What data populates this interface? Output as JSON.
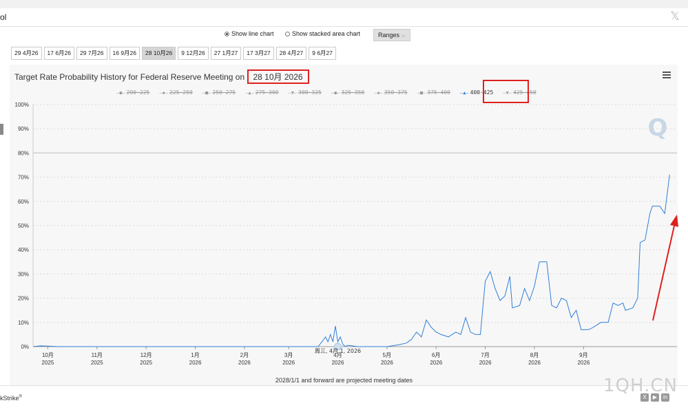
{
  "header": {
    "title_fragment": "ol",
    "close_label": "𝕏"
  },
  "options": {
    "line_label": "Show line chart",
    "stacked_label": "Show stacked area chart",
    "ranges_label": "Ranges",
    "selected": "line"
  },
  "meeting_tabs": [
    "29 4月26",
    "17 6月26",
    "29 7月26",
    "16 9月26",
    "28 10月26",
    "9 12月26",
    "27 1月27",
    "17 3月27",
    "28 4月27",
    "9 6月27"
  ],
  "active_tab": 4,
  "chart": {
    "title_prefix": "Target Rate Probability History for Federal Reserve Meeting on",
    "title_date": "28 10月 2026"
  },
  "legend_items": [
    {
      "label": "200-225",
      "symbol": "●",
      "active": false
    },
    {
      "label": "225-250",
      "symbol": "◆",
      "active": false
    },
    {
      "label": "250-275",
      "symbol": "■",
      "active": false
    },
    {
      "label": "275-300",
      "symbol": "▲",
      "active": false
    },
    {
      "label": "300-325",
      "symbol": "▼",
      "active": false
    },
    {
      "label": "325-350",
      "symbol": "●",
      "active": false
    },
    {
      "label": "350-375",
      "symbol": "◆",
      "active": false
    },
    {
      "label": "375-400",
      "symbol": "■",
      "active": false
    },
    {
      "label": "400-425",
      "symbol": "▲",
      "active": true
    },
    {
      "label": "425-450",
      "symbol": "▼",
      "active": false
    }
  ],
  "tooltip_date": "周三, 4月 1, 2026",
  "footnote": "2028/1/1 and forward are projected meeting dates",
  "credit": "kStrike",
  "credit_mark": "®",
  "watermark": "1QH.CN",
  "logo_letter": "Q",
  "colors": {
    "series": "#2f7ed8",
    "highlight": "#e01f1f",
    "grid": "#d8d8d8"
  },
  "chart_data": {
    "type": "line",
    "title": "Target Rate Probability History for Federal Reserve Meeting on 28 10月 2026",
    "y_unit": "%",
    "ylim": [
      0,
      100
    ],
    "y_ticks": [
      0,
      10,
      20,
      30,
      40,
      50,
      60,
      70,
      80,
      90,
      100
    ],
    "xlim": [
      0,
      13.1
    ],
    "x_ticks": [
      {
        "value": 0.3,
        "month": "10月",
        "year": "2025"
      },
      {
        "value": 1.3,
        "month": "11月",
        "year": "2025"
      },
      {
        "value": 2.3,
        "month": "12月",
        "year": "2025"
      },
      {
        "value": 3.3,
        "month": "1月",
        "year": "2026"
      },
      {
        "value": 4.3,
        "month": "2月",
        "year": "2026"
      },
      {
        "value": 5.2,
        "month": "3月",
        "year": "2026"
      },
      {
        "value": 6.2,
        "month": "4月",
        "year": "2026"
      },
      {
        "value": 7.2,
        "month": "5月",
        "year": "2026"
      },
      {
        "value": 8.2,
        "month": "6月",
        "year": "2026"
      },
      {
        "value": 9.2,
        "month": "7月",
        "year": "2026"
      },
      {
        "value": 10.2,
        "month": "8月",
        "year": "2026"
      },
      {
        "value": 11.2,
        "month": "9月",
        "year": "2026"
      }
    ],
    "series": [
      {
        "name": "400-425",
        "points": [
          [
            0.0,
            0
          ],
          [
            0.15,
            0.3
          ],
          [
            0.3,
            0.2
          ],
          [
            0.5,
            0
          ],
          [
            1.3,
            0
          ],
          [
            2.3,
            0
          ],
          [
            3.3,
            0
          ],
          [
            4.3,
            0
          ],
          [
            5.2,
            0
          ],
          [
            5.8,
            0
          ],
          [
            5.95,
            4
          ],
          [
            6.0,
            2
          ],
          [
            6.05,
            5
          ],
          [
            6.1,
            2
          ],
          [
            6.15,
            8.5
          ],
          [
            6.2,
            2
          ],
          [
            6.25,
            4
          ],
          [
            6.3,
            1
          ],
          [
            6.35,
            0
          ],
          [
            6.4,
            0.5
          ],
          [
            6.5,
            0.3
          ],
          [
            6.6,
            0
          ],
          [
            7.2,
            0
          ],
          [
            7.3,
            0.3
          ],
          [
            7.45,
            0.8
          ],
          [
            7.6,
            1.5
          ],
          [
            7.7,
            3
          ],
          [
            7.8,
            6
          ],
          [
            7.9,
            4
          ],
          [
            8.0,
            11
          ],
          [
            8.1,
            8
          ],
          [
            8.2,
            6
          ],
          [
            8.3,
            5
          ],
          [
            8.45,
            4
          ],
          [
            8.6,
            6
          ],
          [
            8.7,
            5
          ],
          [
            8.8,
            12
          ],
          [
            8.9,
            6
          ],
          [
            9.0,
            5
          ],
          [
            9.1,
            5
          ],
          [
            9.2,
            27
          ],
          [
            9.3,
            31
          ],
          [
            9.4,
            24
          ],
          [
            9.5,
            19
          ],
          [
            9.6,
            21
          ],
          [
            9.7,
            29
          ],
          [
            9.75,
            16
          ],
          [
            9.9,
            17
          ],
          [
            10.0,
            24
          ],
          [
            10.1,
            19
          ],
          [
            10.2,
            25
          ],
          [
            10.3,
            35
          ],
          [
            10.45,
            35
          ],
          [
            10.55,
            17
          ],
          [
            10.65,
            16
          ],
          [
            10.75,
            20
          ],
          [
            10.85,
            19
          ],
          [
            10.95,
            12
          ],
          [
            11.05,
            15
          ],
          [
            11.15,
            7
          ],
          [
            11.3,
            7
          ],
          [
            11.4,
            8
          ],
          [
            11.55,
            10
          ],
          [
            11.7,
            10
          ],
          [
            11.8,
            18
          ],
          [
            11.9,
            17
          ],
          [
            12.0,
            18
          ],
          [
            12.05,
            15
          ],
          [
            12.2,
            16
          ],
          [
            12.3,
            20
          ],
          [
            12.35,
            43
          ],
          [
            12.45,
            44
          ],
          [
            12.55,
            55
          ],
          [
            12.6,
            58
          ],
          [
            12.75,
            58
          ],
          [
            12.85,
            55
          ],
          [
            12.95,
            71
          ]
        ]
      }
    ],
    "grid": true,
    "legend_position": "top",
    "highlighted_point": {
      "x": 6.2,
      "y": 0,
      "label": "周三, 4月 1, 2026"
    }
  }
}
